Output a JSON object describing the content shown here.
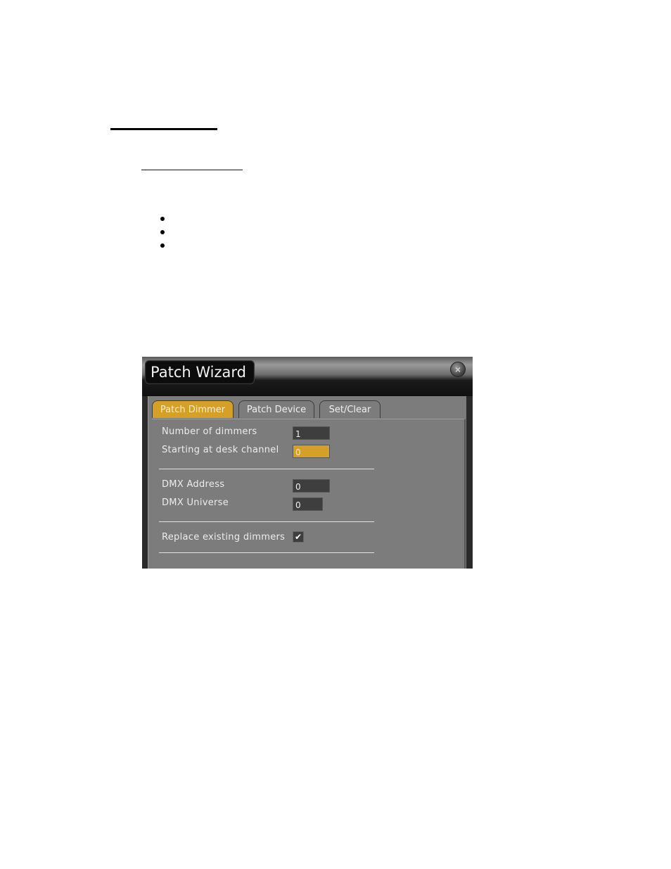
{
  "document": {
    "bullet_count": 3
  },
  "dialog": {
    "title": "Patch Wizard",
    "close_icon": "×",
    "tabs": [
      {
        "label": "Patch Dimmer",
        "active": true
      },
      {
        "label": "Patch Device",
        "active": false
      },
      {
        "label": "Set/Clear",
        "active": false
      }
    ],
    "fields": {
      "number_of_dimmers": {
        "label": "Number of dimmers",
        "value": "1"
      },
      "starting_channel": {
        "label": "Starting at desk channel",
        "value": "0"
      },
      "dmx_address": {
        "label": "DMX Address",
        "value": "0"
      },
      "dmx_universe": {
        "label": "DMX Universe",
        "value": "0"
      }
    },
    "replace_existing": {
      "label": "Replace existing dimmers",
      "checked": true,
      "check_glyph": "✔"
    }
  }
}
